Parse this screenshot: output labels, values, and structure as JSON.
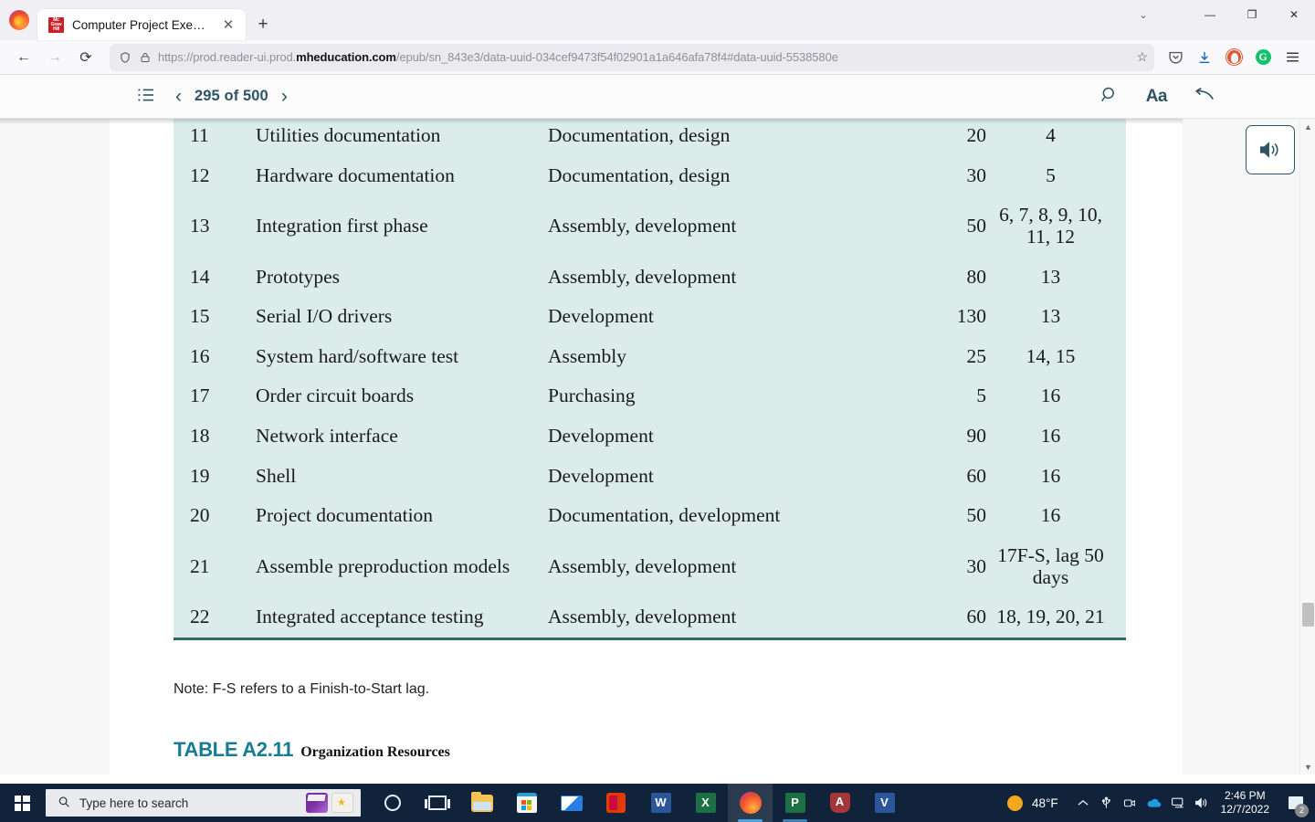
{
  "browser": {
    "tab": {
      "title": "Computer Project Exercises",
      "favicon_text": "Mc Graw Hill",
      "close_label": "✕"
    },
    "newtab_label": "+",
    "window_controls": {
      "list_tabs": "⌄",
      "minimize": "—",
      "restore": "❐",
      "close": "✕"
    },
    "nav": {
      "back": "←",
      "forward": "→",
      "reload": "⟳"
    },
    "url": {
      "scheme_path_pre": "https://prod.reader-ui.prod.",
      "host_bold": "mheducation.com",
      "path_post": "/epub/sn_843e3/data-uuid-034cef9473f54f02901a1a646afa78f4#data-uuid-5538580e",
      "shield_icon": "shield-icon",
      "lock_icon": "lock-icon",
      "bookmark_icon": "☆"
    },
    "extensions": [
      {
        "name": "pocket-icon",
        "glyph": "⭘"
      },
      {
        "name": "downloads-icon",
        "glyph": "⇩"
      },
      {
        "name": "duckduckgo-icon",
        "glyph": ""
      },
      {
        "name": "grammarly-icon",
        "glyph": "G"
      },
      {
        "name": "app-menu-icon",
        "glyph": "☰"
      }
    ]
  },
  "reader": {
    "toc_icon": "☰",
    "prev_label": "‹",
    "next_label": "›",
    "page_indicator": "295 of 500",
    "search_icon": "⚲",
    "font_size_label": "Aa",
    "back_icon": "↩",
    "audio_icon": "🔈"
  },
  "content": {
    "table": {
      "rows": [
        {
          "id": "11",
          "task": "Utilities documentation",
          "resource": "Documentation, design",
          "duration": "20",
          "predecessors": "4"
        },
        {
          "id": "12",
          "task": "Hardware documentation",
          "resource": "Documentation, design",
          "duration": "30",
          "predecessors": "5"
        },
        {
          "id": "13",
          "task": "Integration first phase",
          "resource": "Assembly, development",
          "duration": "50",
          "predecessors": "6, 7, 8, 9, 10, 11, 12"
        },
        {
          "id": "14",
          "task": "Prototypes",
          "resource": "Assembly, development",
          "duration": "80",
          "predecessors": "13"
        },
        {
          "id": "15",
          "task": "Serial I/O drivers",
          "resource": "Development",
          "duration": "130",
          "predecessors": "13"
        },
        {
          "id": "16",
          "task": "System hard/software test",
          "resource": "Assembly",
          "duration": "25",
          "predecessors": "14, 15"
        },
        {
          "id": "17",
          "task": "Order circuit boards",
          "resource": "Purchasing",
          "duration": "5",
          "predecessors": "16"
        },
        {
          "id": "18",
          "task": "Network interface",
          "resource": "Development",
          "duration": "90",
          "predecessors": "16"
        },
        {
          "id": "19",
          "task": "Shell",
          "resource": "Development",
          "duration": "60",
          "predecessors": "16"
        },
        {
          "id": "20",
          "task": "Project documentation",
          "resource": "Documentation, development",
          "duration": "50",
          "predecessors": "16"
        },
        {
          "id": "21",
          "task": "Assemble preproduction models",
          "resource": "Assembly, development",
          "duration": "30",
          "predecessors": "17F-S, lag 50 days"
        },
        {
          "id": "22",
          "task": "Integrated acceptance testing",
          "resource": "Assembly, development",
          "duration": "60",
          "predecessors": "18, 19, 20, 21"
        }
      ]
    },
    "note": "Note: F-S refers to a Finish-to-Start lag.",
    "caption_label": "TABLE A2.11",
    "caption_text": "Organization Resources"
  },
  "taskbar": {
    "search_placeholder": "Type here to search",
    "search_icon": "⌕",
    "apps": [
      {
        "name": "cortana",
        "glyph": ""
      },
      {
        "name": "task-view",
        "glyph": ""
      },
      {
        "name": "file-explorer",
        "glyph": ""
      },
      {
        "name": "microsoft-store",
        "glyph": ""
      },
      {
        "name": "mail",
        "glyph": ""
      },
      {
        "name": "office",
        "glyph": ""
      },
      {
        "name": "word",
        "glyph": "W"
      },
      {
        "name": "excel",
        "glyph": "X"
      },
      {
        "name": "firefox",
        "glyph": ""
      },
      {
        "name": "powerpoint",
        "glyph": "P"
      },
      {
        "name": "access",
        "glyph": "A"
      },
      {
        "name": "visio",
        "glyph": "V"
      }
    ],
    "weather_temp": "48°F",
    "tray": [
      {
        "name": "show-hidden-icons",
        "glyph": "∧"
      },
      {
        "name": "usb-icon",
        "glyph": "⑂"
      },
      {
        "name": "camera-icon",
        "glyph": "◎"
      },
      {
        "name": "onedrive-icon",
        "glyph": "☁"
      },
      {
        "name": "network-icon",
        "glyph": "🖥"
      },
      {
        "name": "volume-icon",
        "glyph": "🔊"
      }
    ],
    "time": "2:46 PM",
    "date": "12/7/2022",
    "notification_count": "2"
  }
}
